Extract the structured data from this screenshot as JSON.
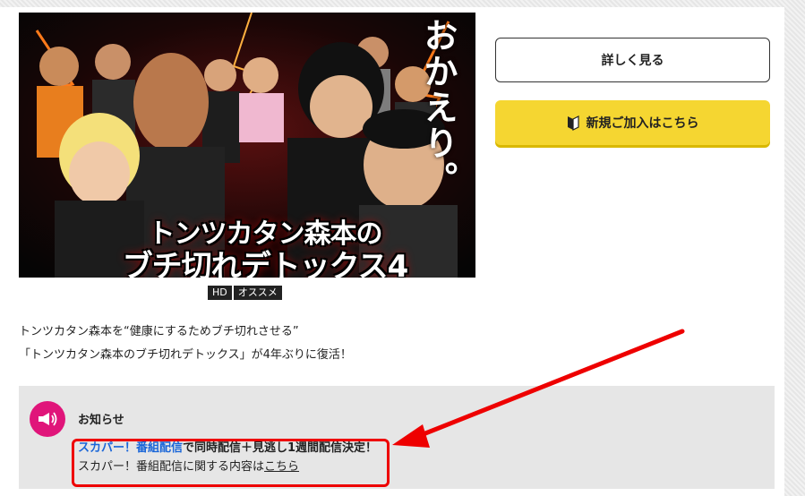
{
  "hero": {
    "title_line1": "トンツカタン森本の",
    "title_line2": "ブチ切れデトックス4",
    "vertical_text": "おかえり。"
  },
  "badges": [
    "HD",
    "オススメ"
  ],
  "buttons": {
    "detail_label": "詳しく見る",
    "join_label": "新規ご加入はこちら",
    "join_icon": "beginner-mark-icon"
  },
  "description": {
    "line1": "トンツカタン森本を“健康にするためブチ切れさせる”",
    "line2": "「トンツカタン森本のブチ切れデトックス」が4年ぶりに復活！"
  },
  "notice": {
    "icon": "megaphone-icon",
    "title": "お知らせ",
    "line1_link": "スカパー！番組配信",
    "line1_text": "で同時配信＋見逃し1週間配信決定！",
    "line2_text": "スカパー！番組配信に関する内容は",
    "line2_link": "こちら"
  },
  "colors": {
    "accent_yellow": "#f5d631",
    "notice_pink": "#e0157a",
    "link_blue": "#1a66d8",
    "annotation_red": "#e00000"
  }
}
